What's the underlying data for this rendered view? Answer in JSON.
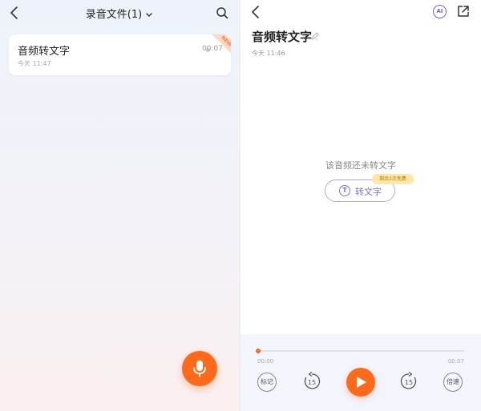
{
  "left": {
    "title": "录音文件(1)",
    "icons": {
      "back": "back-arrow-icon",
      "dropdown": "chevron-down-icon",
      "search": "search-icon",
      "mic": "microphone-icon"
    },
    "recording": {
      "name": "音频转文字",
      "time": "今天 11:47",
      "duration": "00:07",
      "badge": "NEW"
    }
  },
  "right": {
    "icons": {
      "back": "back-arrow-icon",
      "ai": "ai-assistant-icon",
      "share": "share-icon",
      "edit": "pencil-icon",
      "transcribe": "text-t-icon"
    },
    "ai_label": "AI",
    "title": "音频转文字",
    "date": "今天 11:46",
    "empty_message": "该音频还未转文字",
    "transcribe_label": "转文字",
    "free_badge": "剩余2次免费",
    "player": {
      "current_time": "00:00",
      "total_time": "00:07",
      "progress": 0,
      "mark_label": "标记",
      "rewind_label": "15",
      "forward_label": "15",
      "speed_label": "倍速"
    }
  },
  "colors": {
    "accent": "#ff6a1a",
    "purple": "#7b6ee6",
    "free_badge_bg": "#ffe7a8"
  }
}
